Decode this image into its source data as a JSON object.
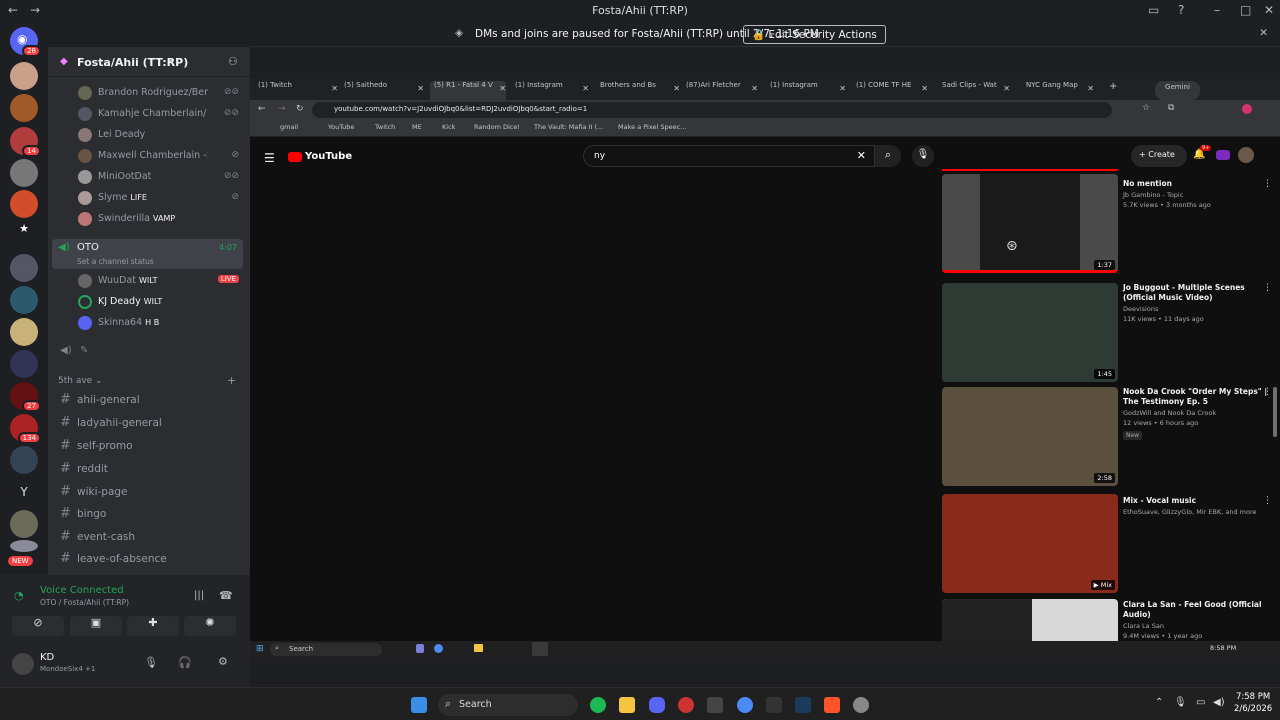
{
  "window": {
    "title": "Fosta/Ahii (TT:RP)"
  },
  "notice": {
    "text": "DMs and joins are paused for Fosta/Ahii (TT:RP) until 2/7, 1:16 PM",
    "action": "Edit Security Actions"
  },
  "rail": {
    "home_badge": "28",
    "badges": [
      "14",
      "27",
      "134"
    ],
    "new_label": "NEW",
    "letter_server": "Y"
  },
  "server": {
    "name": "Fosta/Ahii (TT:RP)"
  },
  "voice_users_top": [
    {
      "name": "Brandon Rodriguez/Benz..."
    },
    {
      "name": "Kamahje Chamberlain/ O..."
    },
    {
      "name": "Lei Deady"
    },
    {
      "name": "Maxwell Chamberlain -> Ma..."
    },
    {
      "name": "MiniOotDat"
    },
    {
      "name": "Slyme",
      "tag": "LIFE"
    },
    {
      "name": "Swinderilla",
      "tag": "VAMP"
    }
  ],
  "voice_channel": {
    "name": "OTO",
    "time": "4:07",
    "status": "Set a channel status"
  },
  "oto_users": [
    {
      "name": "WuuDat",
      "tag": "WILT",
      "live": "LIVE"
    },
    {
      "name": "KJ Deady",
      "tag": "WILT"
    },
    {
      "name": "Skinna64",
      "tag": "H B"
    }
  ],
  "category": {
    "name": "5th ave"
  },
  "text_channels": [
    "ahii-general",
    "ladyahii-general",
    "self-promo",
    "reddit",
    "wiki-page",
    "bingo",
    "event-cash",
    "leave-of-absence"
  ],
  "voice_panel": {
    "status": "Voice Connected",
    "location": "OTO / Fosta/Ahii (TT:RP)"
  },
  "user": {
    "name": "KD",
    "status": "MondoeSix4 +1"
  },
  "browser": {
    "tabs": [
      "(1) Twitch",
      "(5) Saithedo",
      "(5) R1 - Fatal 4 V",
      "(1) Instagram",
      "Brothers and Bs",
      "(87)Ari Fletcher",
      "(1) Instagram",
      "(1) COME TF HE",
      "Sadi Clips - Wat",
      "NYC Gang Map"
    ],
    "gemini": "Gemini",
    "url": "youtube.com/watch?v=J2uvdiOJbq0&list=RDJ2uvdiOJbq0&start_radio=1",
    "bookmarks": [
      "gmail",
      "YouTube",
      "Twitch",
      "ME",
      "Kick",
      "Random Dice!",
      "The Vault: Mafia II (...",
      "Make a Pixel Speec..."
    ]
  },
  "youtube": {
    "logo": "YouTube",
    "search_value": "ny",
    "create": "Create",
    "notif_count": "9+",
    "videos": [
      {
        "title": "No mention",
        "channel": "Jb Gambino - Topic",
        "views": "5.7K views • 3 months ago",
        "duration": "1:37",
        "color": "#4a4a4a"
      },
      {
        "title": "Jo Buggout - Multiple Scenes (Official Music Video)",
        "channel": "Deevisions",
        "views": "11K views • 11 days ago",
        "duration": "1:45",
        "color": "#2e3a34"
      },
      {
        "title": "Nook Da Crook \"Order My Steps\" | The Testimony Ep. 5",
        "channel": "GodzWill and Nook Da Crook",
        "views": "12 views • 6 hours ago",
        "badge": "New",
        "duration": "2:58",
        "color": "#5b4f3e"
      },
      {
        "title": "Mix - Vocal music",
        "channel": "EthoSuave, GlizzyGlo, Mir EBK, and more",
        "views": "",
        "duration": "Mix",
        "color": "#8a2a1a"
      },
      {
        "title": "Clara La San - Feel Good (Official Audio)",
        "channel": "Clara La San",
        "views": "9.4M views • 1 year ago",
        "duration": "",
        "color": "#d8d8d8"
      }
    ]
  },
  "inner_taskbar": {
    "search": "Search",
    "time": "8:58 PM"
  },
  "taskbar": {
    "search": "Search",
    "time": "7:58 PM",
    "date": "2/6/2026"
  }
}
